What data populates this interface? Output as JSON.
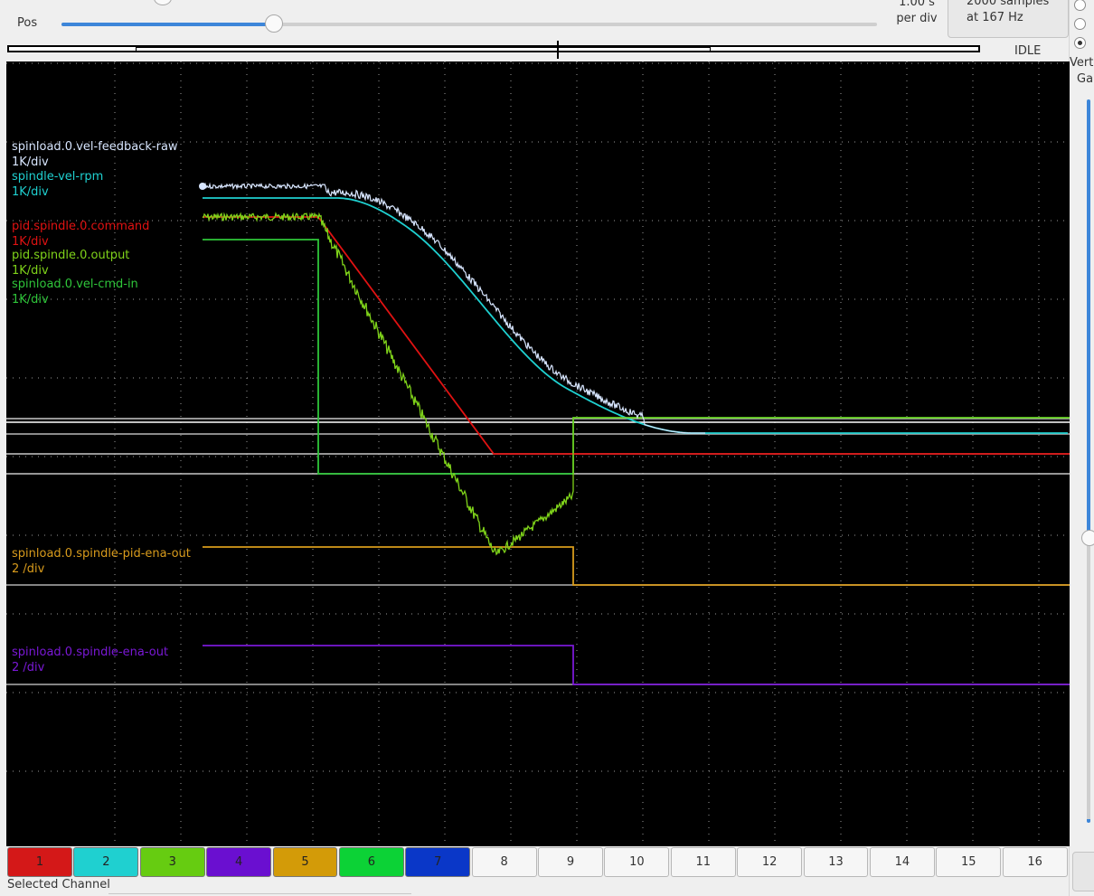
{
  "toolbar": {
    "pos_label": "Pos",
    "pos_value": 0.26,
    "time_per_div_line1": "1.00 s",
    "time_per_div_line2": "per div",
    "samples_line1": "2000 samples",
    "samples_line2": "at 167 Hz",
    "status": "IDLE"
  },
  "right_panel": {
    "label1": "Vert",
    "label2": "Ga"
  },
  "traces": [
    {
      "name": "spinload.0.vel-feedback-raw",
      "scale": "1K/div",
      "color": "#d8e6ff"
    },
    {
      "name": "spindle-vel-rpm",
      "scale": "1K/div",
      "color": "#1fd0d0"
    },
    {
      "name": "pid.spindle.0.command",
      "scale": "1K/div",
      "color": "#e01212"
    },
    {
      "name": "pid.spindle.0.output",
      "scale": "1K/div",
      "color": "#7fd31a"
    },
    {
      "name": "spinload.0.vel-cmd-in",
      "scale": "1K/div",
      "color": "#2fc63a"
    },
    {
      "name": "spinload.0.spindle-pid-ena-out",
      "scale": "2 /div",
      "color": "#d89b1c"
    },
    {
      "name": "spinload.0.spindle-ena-out",
      "scale": "2 /div",
      "color": "#7a18d6"
    }
  ],
  "channels": [
    {
      "label": "1",
      "color": "#d41818"
    },
    {
      "label": "2",
      "color": "#1fd0d0"
    },
    {
      "label": "3",
      "color": "#66cc11"
    },
    {
      "label": "4",
      "color": "#6a0fd0"
    },
    {
      "label": "5",
      "color": "#d39b08"
    },
    {
      "label": "6",
      "color": "#0cd236"
    },
    {
      "label": "7",
      "color": "#0a37c8"
    },
    {
      "label": "8",
      "color": ""
    },
    {
      "label": "9",
      "color": ""
    },
    {
      "label": "10",
      "color": ""
    },
    {
      "label": "11",
      "color": ""
    },
    {
      "label": "12",
      "color": ""
    },
    {
      "label": "13",
      "color": ""
    },
    {
      "label": "14",
      "color": ""
    },
    {
      "label": "15",
      "color": ""
    },
    {
      "label": "16",
      "color": ""
    }
  ],
  "footer": {
    "selected_channel": "Selected Channel"
  }
}
